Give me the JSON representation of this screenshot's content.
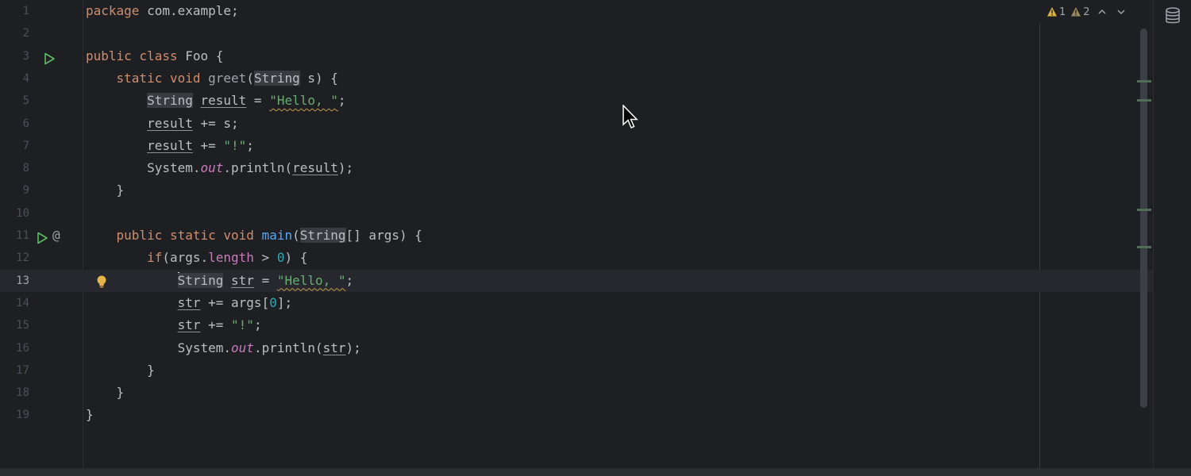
{
  "editor": {
    "lines": [
      {
        "n": "1",
        "html": "<span class=\"kw\">package</span> com.example;"
      },
      {
        "n": "2",
        "html": ""
      },
      {
        "n": "3",
        "html": "<span class=\"kw\">public class</span> Foo {"
      },
      {
        "n": "4",
        "html": "    <span class=\"kw\">static void</span> <span class=\"greet\">greet</span>(<span class=\"hl\">String</span> s) {"
      },
      {
        "n": "5",
        "html": "        <span class=\"hl\">String</span> <span class=\"ul\">result</span> = <span class=\"str warn-wavy\">\"Hello, \"</span>;"
      },
      {
        "n": "6",
        "html": "        <span class=\"ul\">result</span> += s;"
      },
      {
        "n": "7",
        "html": "        <span class=\"ul\">result</span> += <span class=\"str\">\"!\"</span>;"
      },
      {
        "n": "8",
        "html": "        System.<span class=\"sfld\">out</span>.println(<span class=\"ul\">result</span>);"
      },
      {
        "n": "9",
        "html": "    }"
      },
      {
        "n": "10",
        "html": ""
      },
      {
        "n": "11",
        "html": "    <span class=\"kw\">public static void</span> <span class=\"fn\">main</span>(<span class=\"hl\">String</span>[] args) {"
      },
      {
        "n": "12",
        "html": "        <span class=\"kw\">if</span>(args.<span class=\"fld\">length</span> &gt; <span class=\"num\">0</span>) {"
      },
      {
        "n": "13",
        "html": "            <span class=\"caret\"></span><span class=\"hl\">String</span> <span class=\"ul\">str</span> = <span class=\"str warn-wavy\">\"Hello, \"</span>;"
      },
      {
        "n": "14",
        "html": "            <span class=\"ul\">str</span> += args[<span class=\"num\">0</span>];"
      },
      {
        "n": "15",
        "html": "            <span class=\"ul\">str</span> += <span class=\"str\">\"!\"</span>;"
      },
      {
        "n": "16",
        "html": "            System.<span class=\"sfld\">out</span>.println(<span class=\"ul\">str</span>);"
      },
      {
        "n": "17",
        "html": "        }"
      },
      {
        "n": "18",
        "html": "    }"
      },
      {
        "n": "19",
        "html": "}"
      }
    ]
  },
  "inspections": {
    "warnings_count": "1",
    "weak_warnings_count": "2"
  },
  "icons": {
    "run": "run-icon",
    "implements": "at-icon",
    "bulb": "lightbulb-icon",
    "database": "database-icon"
  },
  "colors": {
    "background": "#1e1f22",
    "keyword": "#cf8e6d",
    "string": "#6aab73",
    "number": "#2aacb8",
    "method": "#56a8f5",
    "field": "#c77dbb",
    "warning": "#e0b13f"
  }
}
